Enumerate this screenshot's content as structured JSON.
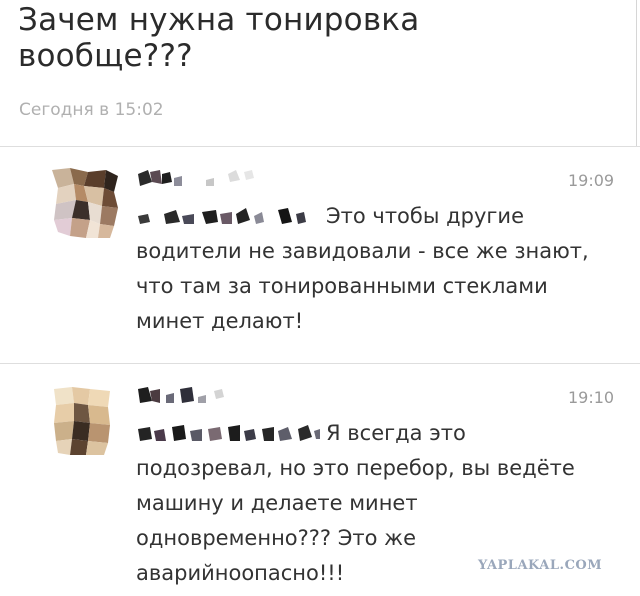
{
  "post": {
    "title": "Зачем нужна тонировка вообще???",
    "time": "Сегодня в 15:02"
  },
  "comments": [
    {
      "time": "19:09",
      "text": "Это чтобы другие водители не завидовали - все же знают, что там за тонированными стеклами минет делают!"
    },
    {
      "time": "19:10",
      "text": "Я всегда это подозревал, но это перебор, вы ведёте машину и делаете минет одновременно??? Это же аварийноопасно!!!"
    }
  ],
  "watermark": "YAPLAKAL.COM"
}
